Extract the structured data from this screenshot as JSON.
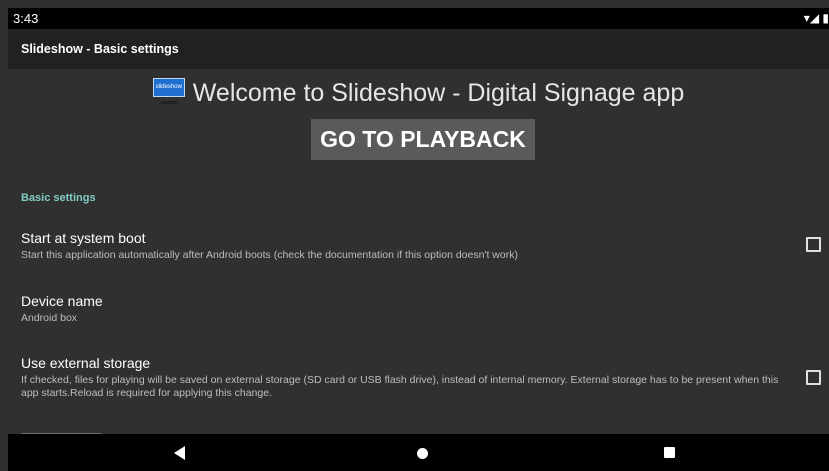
{
  "status": {
    "time": "3:43",
    "icons": "▾◢ ▮"
  },
  "appbar": {
    "title": "Slideshow - Basic settings"
  },
  "welcome": {
    "text": "Welcome to Slideshow - Digital Signage app",
    "logo_text": "slideshow"
  },
  "playback_button": {
    "label": "GO TO PLAYBACK"
  },
  "section": {
    "title": "Basic settings"
  },
  "preferences": [
    {
      "title": "Start at system boot",
      "summary": "Start this application automatically after Android boots (check the documentation if this option doesn't work)",
      "checked": false
    },
    {
      "title": "Device name",
      "summary": "Android box"
    },
    {
      "title": "Use external storage",
      "summary": "If checked, files for playing will be saved on external storage (SD card or USB flash drive), instead of internal memory. External storage has to be present when this app starts.Reload is required for applying this change.",
      "checked": false
    }
  ],
  "navbar": {
    "back": "back-icon",
    "home": "home-icon",
    "recents": "recents-icon"
  },
  "colors": {
    "background": "#303030",
    "appbar": "#212121",
    "accent": "#80cbc4",
    "button": "#5a5a5a"
  }
}
